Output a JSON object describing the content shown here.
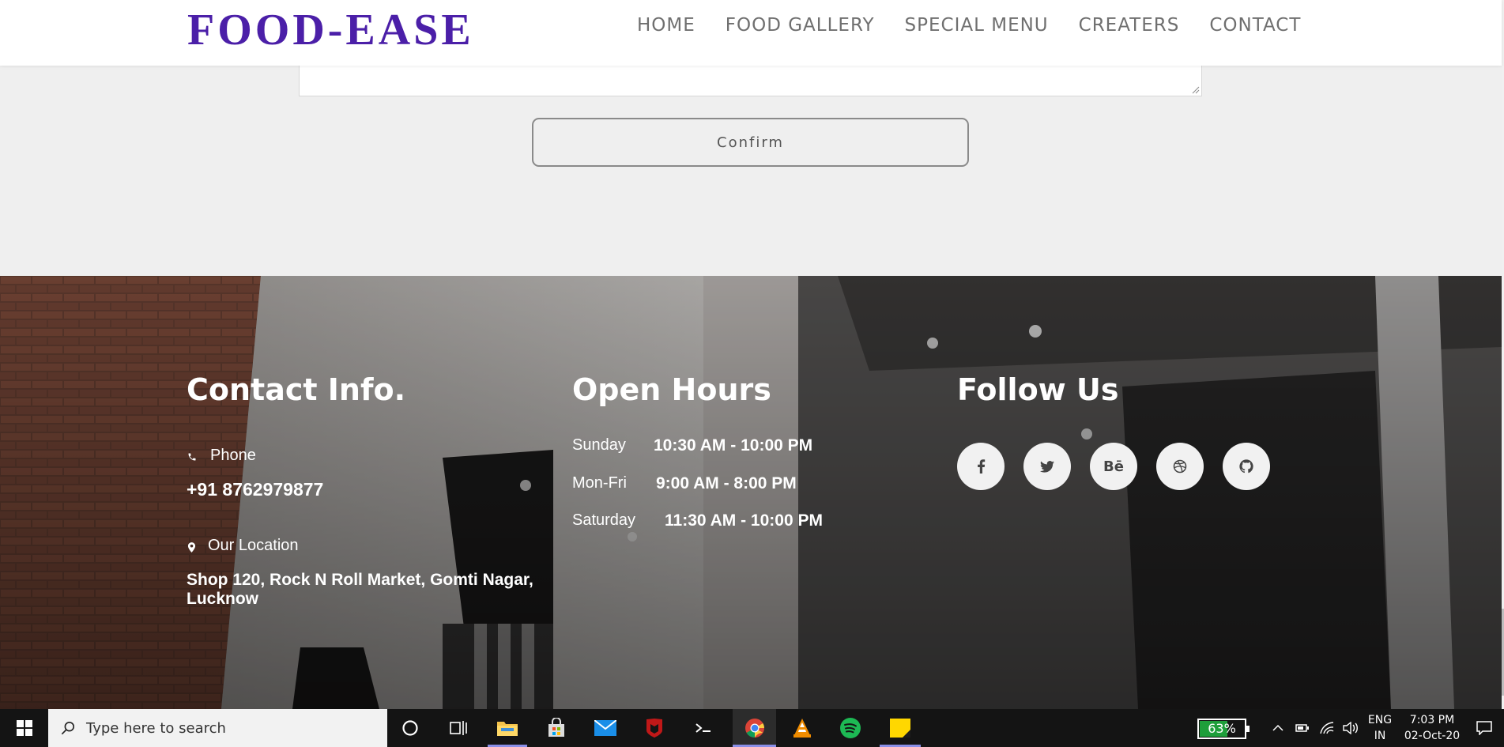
{
  "header": {
    "brand": "FOOD-EASE",
    "nav": [
      {
        "label": "HOME"
      },
      {
        "label": "FOOD GALLERY"
      },
      {
        "label": "SPECIAL MENU"
      },
      {
        "label": "CREATERS"
      },
      {
        "label": "CONTACT"
      }
    ]
  },
  "form": {
    "confirm_label": "Confirm"
  },
  "footer": {
    "contact": {
      "title": "Contact Info.",
      "phone_label": "Phone",
      "phone_value": "+91 8762979877",
      "location_label": "Our Location",
      "location_line1": "Shop 120, Rock N Roll Market, Gomti Nagar,",
      "location_line2": "Lucknow"
    },
    "hours": {
      "title": "Open Hours",
      "rows": [
        {
          "day": "Sunday",
          "time": "10:30 AM - 10:00 PM"
        },
        {
          "day": "Mon-Fri",
          "time": "9:00 AM - 8:00 PM"
        },
        {
          "day": "Saturday",
          "time": "11:30 AM - 10:00 PM"
        }
      ]
    },
    "follow": {
      "title": "Follow Us",
      "icons": [
        "facebook-icon",
        "twitter-icon",
        "behance-icon",
        "dribbble-icon",
        "github-icon"
      ],
      "behance_glyph": "Bē"
    }
  },
  "taskbar": {
    "search_placeholder": "Type here to search",
    "battery": "63%",
    "lang_line1": "ENG",
    "lang_line2": "IN",
    "time": "7:03 PM",
    "date": "02-Oct-20",
    "apps": [
      "cortana-icon",
      "task-view-icon",
      "file-explorer-icon",
      "store-icon",
      "mail-icon",
      "mcafee-icon",
      "terminal-icon",
      "chrome-icon",
      "vlc-icon",
      "spotify-icon",
      "sticky-notes-icon"
    ]
  },
  "colors": {
    "brand": "#4b1fa8",
    "nav": "#6f6f6f",
    "battery": "#1e9e3a"
  }
}
